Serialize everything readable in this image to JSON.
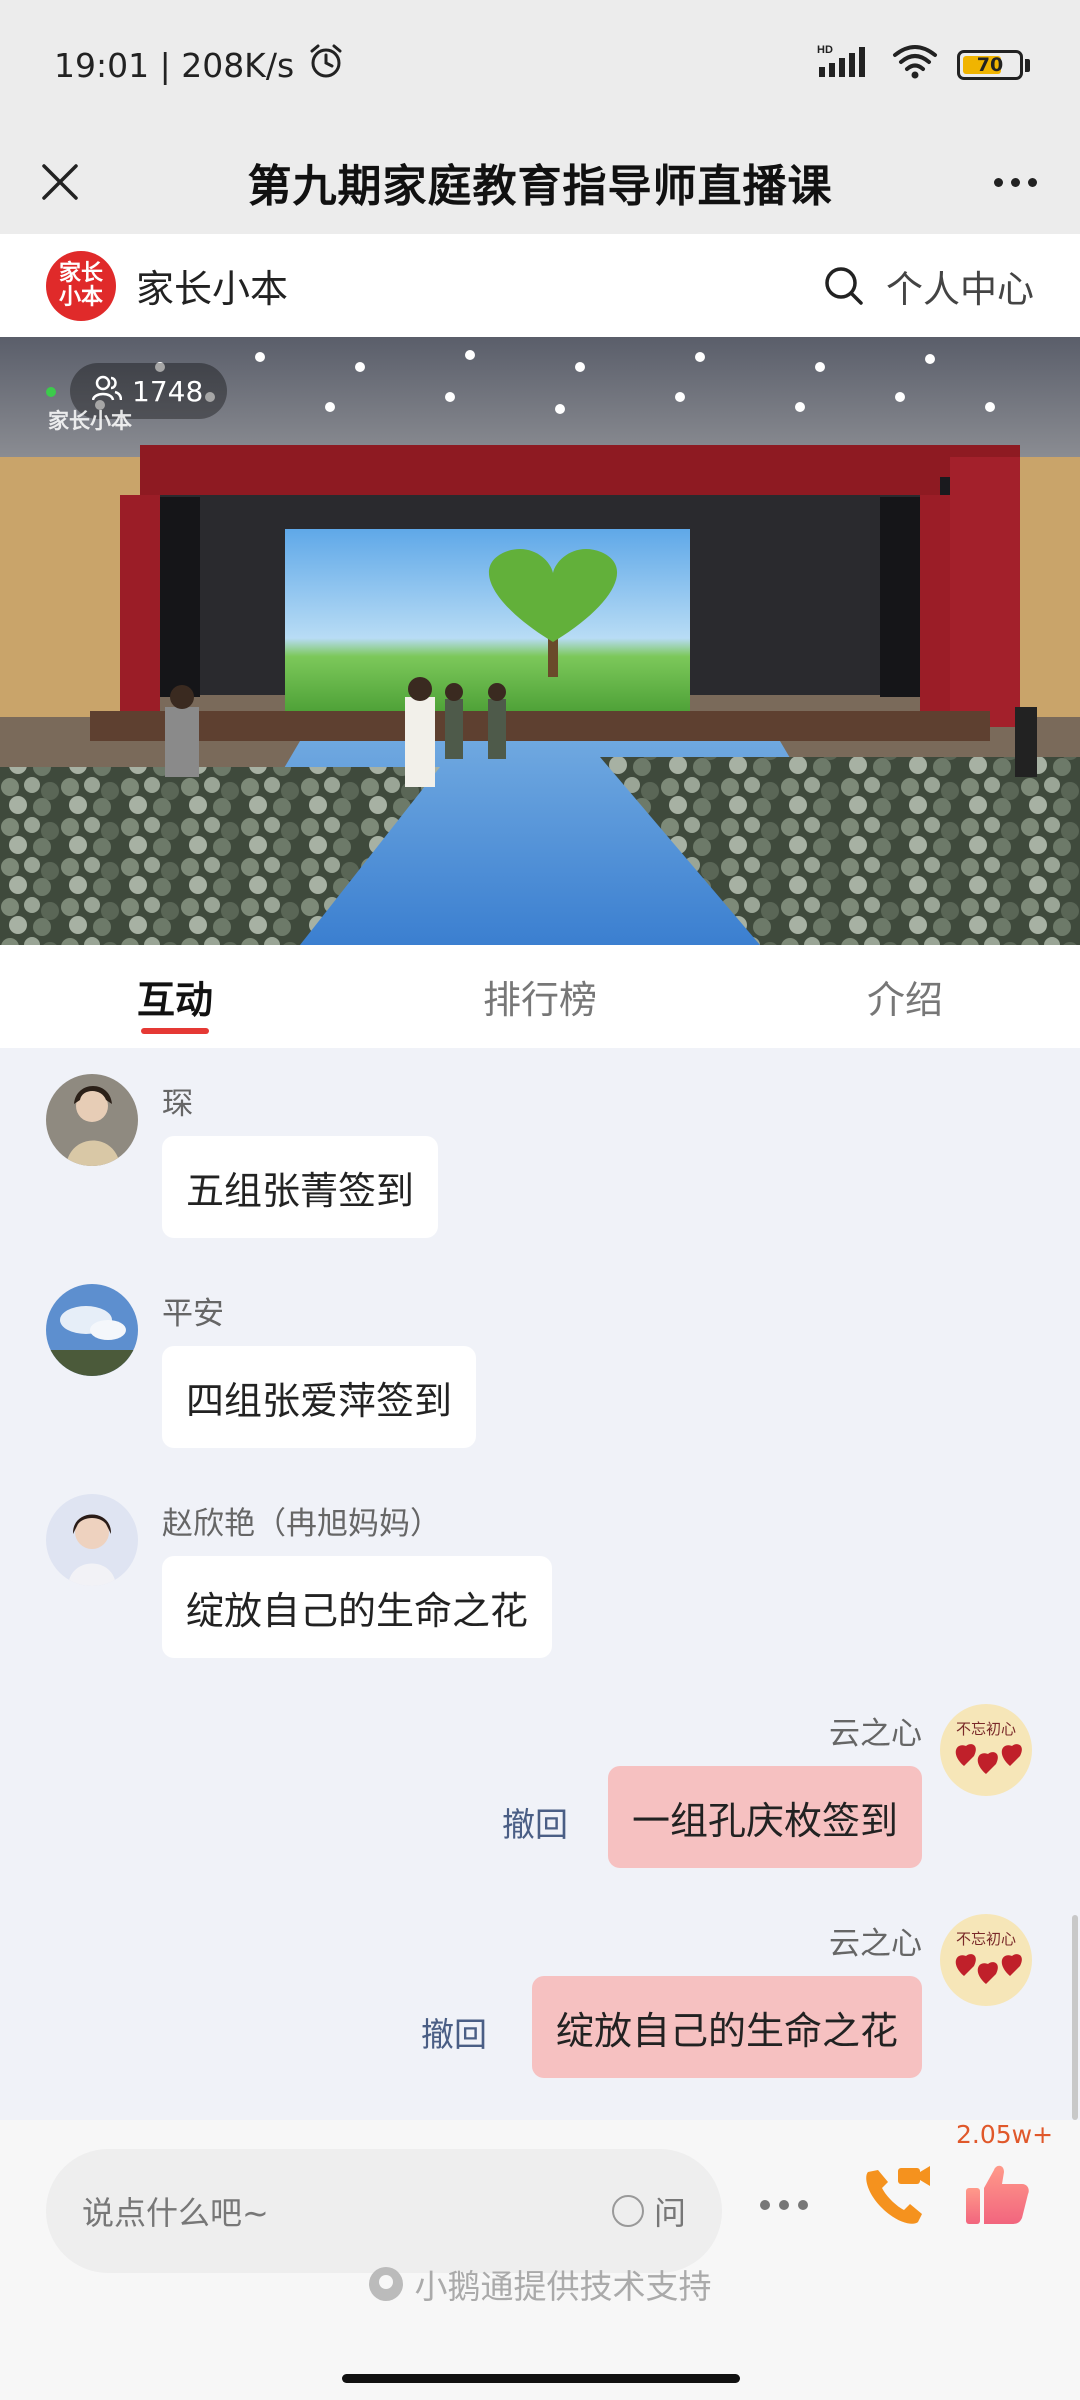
{
  "status_bar": {
    "time_speed": "19:01 | 208K/s",
    "battery": "70",
    "battery_level": 0.7,
    "icons": [
      "alarm-icon",
      "hd-signal-icon",
      "wifi-icon",
      "battery-icon"
    ]
  },
  "title_bar": {
    "title": "第九期家庭教育指导师直播课",
    "icons": [
      "close-icon",
      "more-icon"
    ]
  },
  "brand": {
    "logo_text": "家长小本",
    "name": "家长小本",
    "personal_center": "个人中心",
    "icons": [
      "search-icon"
    ]
  },
  "video": {
    "viewer_count": "1748",
    "watermark": "家长小本",
    "colors": {
      "live_dot": "#3ccb4b"
    }
  },
  "tabs": [
    {
      "label": "互动",
      "active": true
    },
    {
      "label": "排行榜",
      "active": false
    },
    {
      "label": "介绍",
      "active": false
    }
  ],
  "chat": {
    "messages": [
      {
        "side": "left",
        "name": "琛",
        "text": "五组张菁签到"
      },
      {
        "side": "left",
        "name": "平安",
        "text": "四组张爱萍签到"
      },
      {
        "side": "left",
        "name": "赵欣艳（冉旭妈妈）",
        "text": "绽放自己的生命之花"
      },
      {
        "side": "right",
        "name": "云之心",
        "text": "一组孔庆枚签到",
        "recall": "撤回",
        "avatar_text": "不忘初心"
      },
      {
        "side": "right",
        "name": "云之心",
        "text": "绽放自己的生命之花",
        "recall": "撤回",
        "avatar_text": "不忘初心"
      }
    ]
  },
  "bottom": {
    "input_placeholder": "说点什么吧~",
    "ask_label": "问",
    "like_count": "2.05w+",
    "support_text": "小鹅通提供技术支持",
    "icons": [
      "more-icon",
      "video-call-icon",
      "thumbs-up-icon",
      "xiaoetong-icon"
    ]
  },
  "colors": {
    "accent": "#e53935",
    "bubble_self": "#f6c1c1",
    "recall": "#4a5e85",
    "like_count": "#e0582a"
  }
}
